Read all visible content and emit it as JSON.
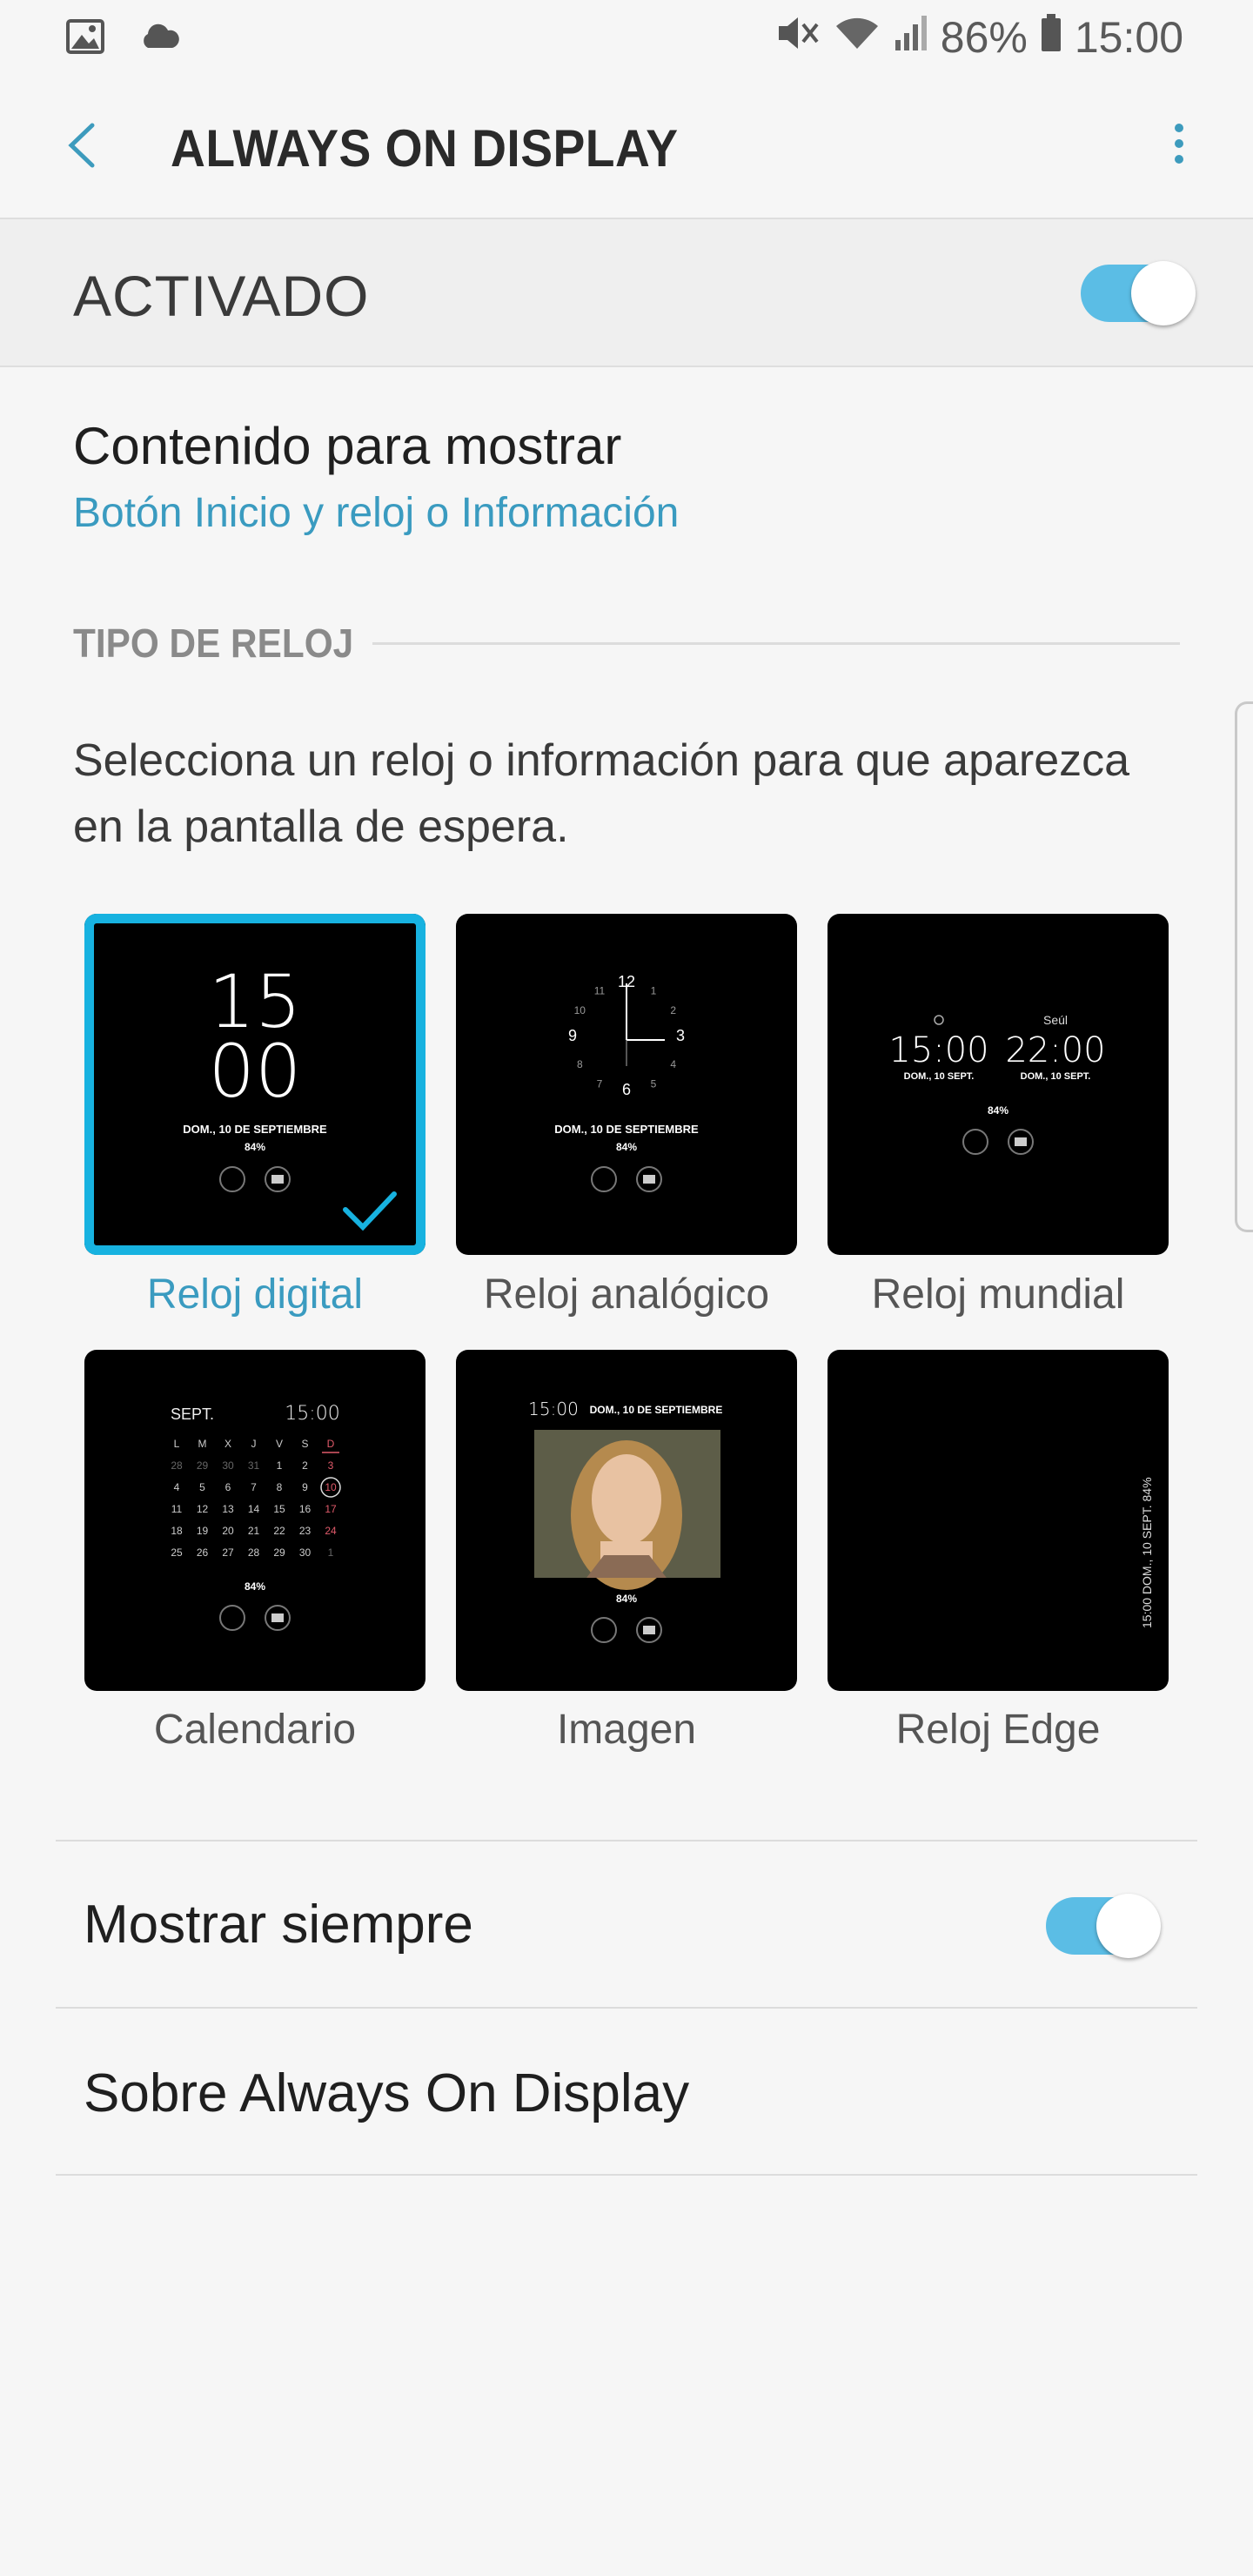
{
  "status_bar": {
    "battery": "86%",
    "time": "15:00"
  },
  "app_bar": {
    "title": "ALWAYS ON DISPLAY"
  },
  "master_switch": {
    "label": "ACTIVADO",
    "on": true
  },
  "content": {
    "title": "Contenido para mostrar",
    "value": "Botón Inicio y reloj o Información"
  },
  "clock_section": {
    "header": "TIPO DE RELOJ",
    "description": "Selecciona un reloj o información para que aparezca en la pantalla de espera.",
    "options": [
      {
        "label": "Reloj digital",
        "selected": true
      },
      {
        "label": "Reloj analógico",
        "selected": false
      },
      {
        "label": "Reloj mundial",
        "selected": false
      },
      {
        "label": "Calendario",
        "selected": false
      },
      {
        "label": "Imagen",
        "selected": false
      },
      {
        "label": "Reloj Edge",
        "selected": false
      }
    ]
  },
  "previews": {
    "digital_hour": "15",
    "digital_min": "00",
    "date_long": "DOM., 10 DE SEPTIEMBRE",
    "battery": "84%",
    "analog_numbers": [
      "12",
      "1",
      "2",
      "3",
      "4",
      "5",
      "6",
      "7",
      "8",
      "9",
      "10",
      "11"
    ],
    "world_city": "Seúl",
    "world_time_local": "15:00",
    "world_time_remote": "22:00",
    "world_date": "DOM., 10 SEPT.",
    "cal_month": "SEPT.",
    "cal_time": "15:00",
    "cal_days_header": [
      "L",
      "M",
      "X",
      "J",
      "V",
      "S",
      "D"
    ],
    "cal_rows": [
      [
        "28",
        "29",
        "30",
        "31",
        "1",
        "2",
        "3"
      ],
      [
        "4",
        "5",
        "6",
        "7",
        "8",
        "9",
        "10"
      ],
      [
        "11",
        "12",
        "13",
        "14",
        "15",
        "16",
        "17"
      ],
      [
        "18",
        "19",
        "20",
        "21",
        "22",
        "23",
        "24"
      ],
      [
        "25",
        "26",
        "27",
        "28",
        "29",
        "30",
        "1"
      ]
    ],
    "image_time": "15:00",
    "image_date": "DOM., 10 DE SEPTIEMBRE",
    "edge_text": "15:00  DOM., 10 SEPT.  84%"
  },
  "list": {
    "show_always": "Mostrar siempre",
    "show_always_on": true,
    "about": "Sobre Always On Display"
  },
  "colors": {
    "accent": "#3a9bc0",
    "toggle_on": "#5bbde5",
    "selection": "#17b2e0"
  }
}
